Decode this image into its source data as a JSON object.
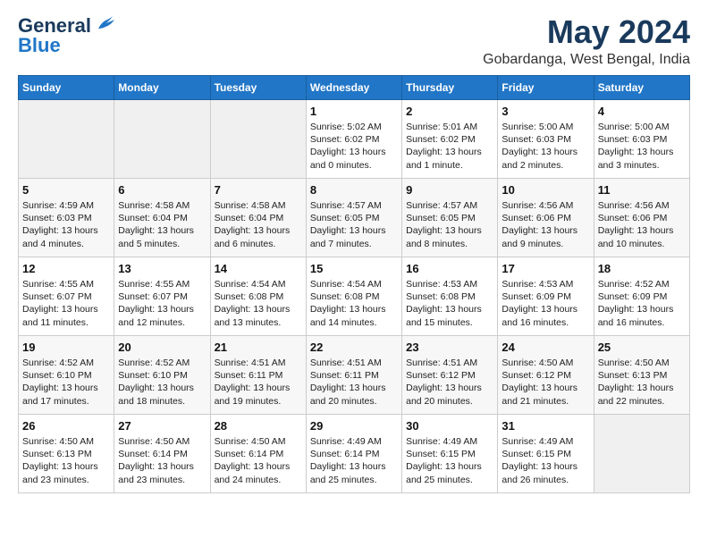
{
  "header": {
    "logo_line1": "General",
    "logo_line2": "Blue",
    "month": "May 2024",
    "location": "Gobardanga, West Bengal, India"
  },
  "days_of_week": [
    "Sunday",
    "Monday",
    "Tuesday",
    "Wednesday",
    "Thursday",
    "Friday",
    "Saturday"
  ],
  "weeks": [
    [
      {
        "day": "",
        "content": ""
      },
      {
        "day": "",
        "content": ""
      },
      {
        "day": "",
        "content": ""
      },
      {
        "day": "1",
        "content": "Sunrise: 5:02 AM\nSunset: 6:02 PM\nDaylight: 13 hours\nand 0 minutes."
      },
      {
        "day": "2",
        "content": "Sunrise: 5:01 AM\nSunset: 6:02 PM\nDaylight: 13 hours\nand 1 minute."
      },
      {
        "day": "3",
        "content": "Sunrise: 5:00 AM\nSunset: 6:03 PM\nDaylight: 13 hours\nand 2 minutes."
      },
      {
        "day": "4",
        "content": "Sunrise: 5:00 AM\nSunset: 6:03 PM\nDaylight: 13 hours\nand 3 minutes."
      }
    ],
    [
      {
        "day": "5",
        "content": "Sunrise: 4:59 AM\nSunset: 6:03 PM\nDaylight: 13 hours\nand 4 minutes."
      },
      {
        "day": "6",
        "content": "Sunrise: 4:58 AM\nSunset: 6:04 PM\nDaylight: 13 hours\nand 5 minutes."
      },
      {
        "day": "7",
        "content": "Sunrise: 4:58 AM\nSunset: 6:04 PM\nDaylight: 13 hours\nand 6 minutes."
      },
      {
        "day": "8",
        "content": "Sunrise: 4:57 AM\nSunset: 6:05 PM\nDaylight: 13 hours\nand 7 minutes."
      },
      {
        "day": "9",
        "content": "Sunrise: 4:57 AM\nSunset: 6:05 PM\nDaylight: 13 hours\nand 8 minutes."
      },
      {
        "day": "10",
        "content": "Sunrise: 4:56 AM\nSunset: 6:06 PM\nDaylight: 13 hours\nand 9 minutes."
      },
      {
        "day": "11",
        "content": "Sunrise: 4:56 AM\nSunset: 6:06 PM\nDaylight: 13 hours\nand 10 minutes."
      }
    ],
    [
      {
        "day": "12",
        "content": "Sunrise: 4:55 AM\nSunset: 6:07 PM\nDaylight: 13 hours\nand 11 minutes."
      },
      {
        "day": "13",
        "content": "Sunrise: 4:55 AM\nSunset: 6:07 PM\nDaylight: 13 hours\nand 12 minutes."
      },
      {
        "day": "14",
        "content": "Sunrise: 4:54 AM\nSunset: 6:08 PM\nDaylight: 13 hours\nand 13 minutes."
      },
      {
        "day": "15",
        "content": "Sunrise: 4:54 AM\nSunset: 6:08 PM\nDaylight: 13 hours\nand 14 minutes."
      },
      {
        "day": "16",
        "content": "Sunrise: 4:53 AM\nSunset: 6:08 PM\nDaylight: 13 hours\nand 15 minutes."
      },
      {
        "day": "17",
        "content": "Sunrise: 4:53 AM\nSunset: 6:09 PM\nDaylight: 13 hours\nand 16 minutes."
      },
      {
        "day": "18",
        "content": "Sunrise: 4:52 AM\nSunset: 6:09 PM\nDaylight: 13 hours\nand 16 minutes."
      }
    ],
    [
      {
        "day": "19",
        "content": "Sunrise: 4:52 AM\nSunset: 6:10 PM\nDaylight: 13 hours\nand 17 minutes."
      },
      {
        "day": "20",
        "content": "Sunrise: 4:52 AM\nSunset: 6:10 PM\nDaylight: 13 hours\nand 18 minutes."
      },
      {
        "day": "21",
        "content": "Sunrise: 4:51 AM\nSunset: 6:11 PM\nDaylight: 13 hours\nand 19 minutes."
      },
      {
        "day": "22",
        "content": "Sunrise: 4:51 AM\nSunset: 6:11 PM\nDaylight: 13 hours\nand 20 minutes."
      },
      {
        "day": "23",
        "content": "Sunrise: 4:51 AM\nSunset: 6:12 PM\nDaylight: 13 hours\nand 20 minutes."
      },
      {
        "day": "24",
        "content": "Sunrise: 4:50 AM\nSunset: 6:12 PM\nDaylight: 13 hours\nand 21 minutes."
      },
      {
        "day": "25",
        "content": "Sunrise: 4:50 AM\nSunset: 6:13 PM\nDaylight: 13 hours\nand 22 minutes."
      }
    ],
    [
      {
        "day": "26",
        "content": "Sunrise: 4:50 AM\nSunset: 6:13 PM\nDaylight: 13 hours\nand 23 minutes."
      },
      {
        "day": "27",
        "content": "Sunrise: 4:50 AM\nSunset: 6:14 PM\nDaylight: 13 hours\nand 23 minutes."
      },
      {
        "day": "28",
        "content": "Sunrise: 4:50 AM\nSunset: 6:14 PM\nDaylight: 13 hours\nand 24 minutes."
      },
      {
        "day": "29",
        "content": "Sunrise: 4:49 AM\nSunset: 6:14 PM\nDaylight: 13 hours\nand 25 minutes."
      },
      {
        "day": "30",
        "content": "Sunrise: 4:49 AM\nSunset: 6:15 PM\nDaylight: 13 hours\nand 25 minutes."
      },
      {
        "day": "31",
        "content": "Sunrise: 4:49 AM\nSunset: 6:15 PM\nDaylight: 13 hours\nand 26 minutes."
      },
      {
        "day": "",
        "content": ""
      }
    ]
  ]
}
